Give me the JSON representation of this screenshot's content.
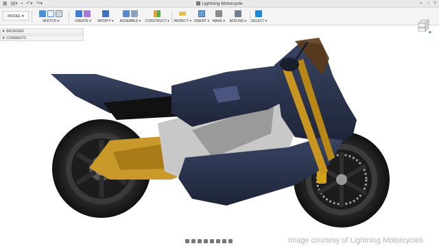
{
  "window": {
    "title": "Lightning Motorcycle"
  },
  "toolbar": {
    "workspace": "MODEL",
    "groups": [
      {
        "label": "SKETCH",
        "icons": [
          "sketch-icon",
          "line-icon",
          "rectangle-icon"
        ]
      },
      {
        "label": "CREATE",
        "icons": [
          "extrude-icon",
          "form-icon"
        ]
      },
      {
        "label": "MODIFY",
        "icons": [
          "modify-icon"
        ]
      },
      {
        "label": "ASSEMBLE",
        "icons": [
          "new-component-icon",
          "joint-icon"
        ]
      },
      {
        "label": "CONSTRUCT",
        "icons": [
          "plane-icon"
        ]
      },
      {
        "label": "INSPECT",
        "icons": [
          "measure-icon"
        ]
      },
      {
        "label": "INSERT",
        "icons": [
          "insert-image-icon"
        ]
      },
      {
        "label": "MAKE",
        "icons": [
          "print-icon"
        ]
      },
      {
        "label": "ADD-INS",
        "icons": [
          "scripts-icon"
        ]
      },
      {
        "label": "SELECT",
        "icons": [
          "select-icon"
        ]
      }
    ]
  },
  "panels": {
    "browser": "BROWSER",
    "comments": "COMMENTS"
  },
  "viewcube": {
    "face": "FRONT"
  },
  "credit": "Image courtesy of Lightning Motorcycles",
  "colors": {
    "bike_body": "#2c3650",
    "bike_gold": "#c99a2a",
    "tire": "#1a1a1a",
    "select_blue": "#1e88d8"
  }
}
